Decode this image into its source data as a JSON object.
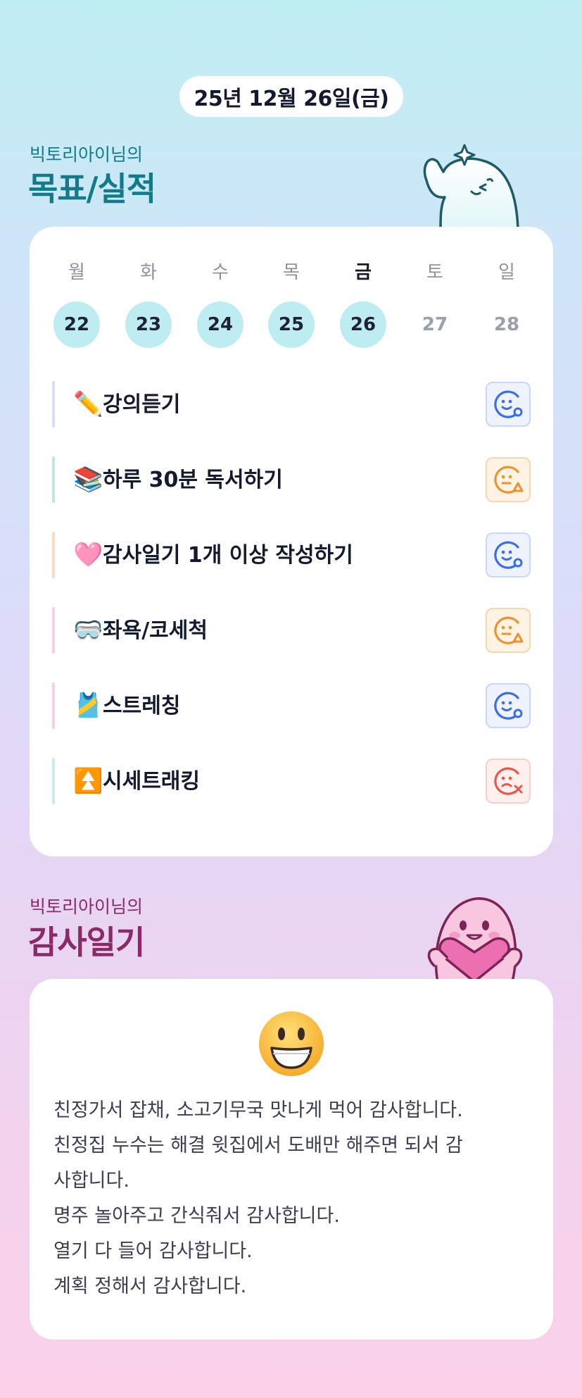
{
  "header": {
    "date": "25년 12월 26일(금)"
  },
  "goals_section": {
    "owner_line": "빅토리아이님의",
    "title": "목표/실적",
    "week": [
      {
        "name": "월",
        "date": "22",
        "state": "done"
      },
      {
        "name": "화",
        "date": "23",
        "state": "done"
      },
      {
        "name": "수",
        "date": "24",
        "state": "done"
      },
      {
        "name": "목",
        "date": "25",
        "state": "done"
      },
      {
        "name": "금",
        "date": "26",
        "state": "today"
      },
      {
        "name": "토",
        "date": "27",
        "state": "future"
      },
      {
        "name": "일",
        "date": "28",
        "state": "future"
      }
    ],
    "goals": [
      {
        "emoji": "✏️",
        "label": "강의듣기",
        "status": "achieved",
        "bar_color": "#d7defa"
      },
      {
        "emoji": "📚",
        "label": "하루 30분 독서하기",
        "status": "partial",
        "bar_color": "#bfe9d9"
      },
      {
        "emoji": "🩷",
        "label": "감사일기 1개 이상 작성하기",
        "status": "achieved",
        "bar_color": "#f8dcc0"
      },
      {
        "emoji": "🥽",
        "label": "좌욕/코세척",
        "status": "partial",
        "bar_color": "#f7cfe6"
      },
      {
        "emoji": "🎽",
        "label": "스트레칭",
        "status": "achieved",
        "bar_color": "#f7cfe6"
      },
      {
        "emoji": "⏫",
        "label": "시세트래킹",
        "status": "failed",
        "bar_color": "#c8ecf2"
      }
    ]
  },
  "diary_section": {
    "owner_line": "빅토리아이님의",
    "title": "감사일기",
    "mood_emoji": "grinning-face",
    "lines": [
      "친정가서 잡채, 소고기무국 맛나게 먹어 감사합니다.",
      "친정집 누수는 해결 윗집에서 도배만 해주면 되서 감",
      "사합니다.",
      "명주 놀아주고 간식줘서 감사합니다.",
      "열기 다 들어 감사합니다.",
      "계획 정해서 감사합니다."
    ]
  },
  "colors": {
    "accent_teal": "#137a87",
    "accent_plum": "#8b2a66",
    "achieved": "#3a6ee8",
    "partial": "#f0922b",
    "failed": "#e8574a",
    "done_day": "#bdedf1"
  }
}
